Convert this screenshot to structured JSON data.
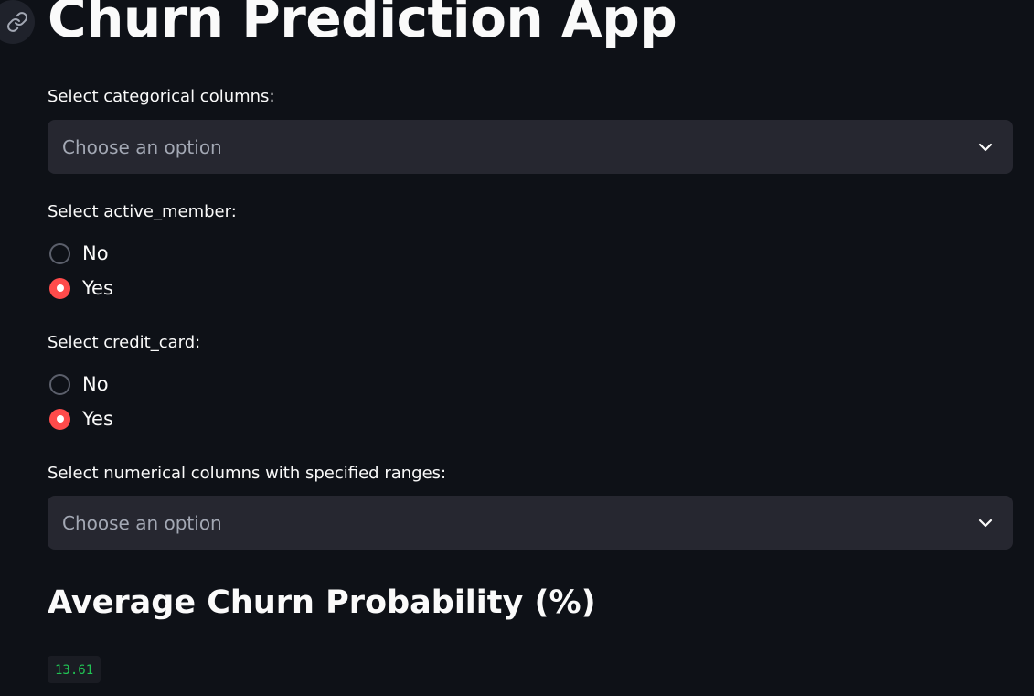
{
  "header": {
    "title": "Churn Prediction App"
  },
  "categorical": {
    "label": "Select categorical columns:",
    "placeholder": "Choose an option"
  },
  "active_member": {
    "label": "Select active_member:",
    "options": [
      "No",
      "Yes"
    ],
    "selected": "Yes"
  },
  "credit_card": {
    "label": "Select credit_card:",
    "options": [
      "No",
      "Yes"
    ],
    "selected": "Yes"
  },
  "numerical": {
    "label": "Select numerical columns with specified ranges:",
    "placeholder": "Choose an option"
  },
  "result": {
    "heading": "Average Churn Probability (%)",
    "value": "13.61"
  },
  "colors": {
    "background": "#0e1117",
    "select_bg": "#262730",
    "accent": "#ff4b4b",
    "code_text": "#21c354"
  },
  "icons": {
    "anchor": "link-icon",
    "dropdown": "chevron-down-icon"
  }
}
